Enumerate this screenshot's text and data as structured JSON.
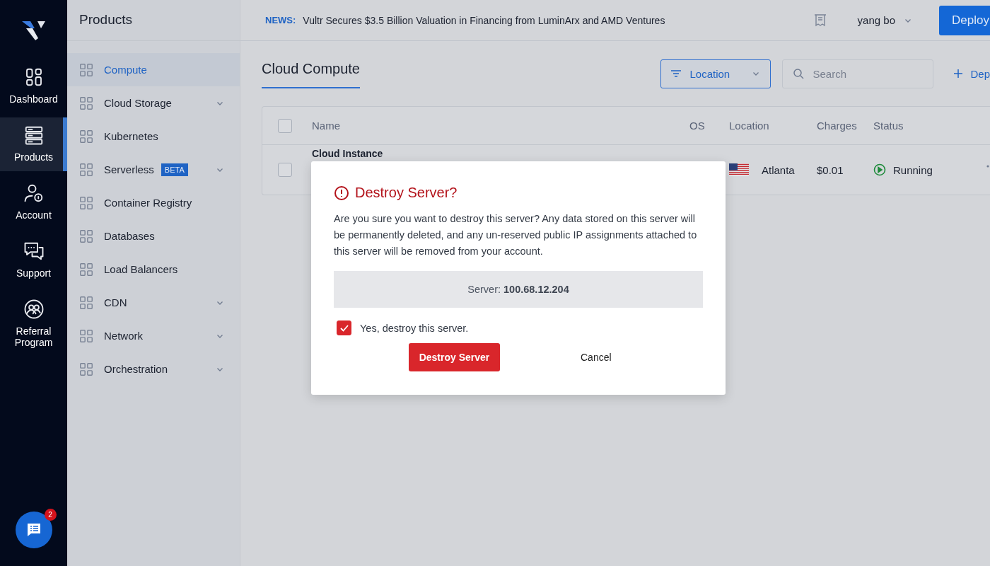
{
  "rail": {
    "items": [
      {
        "label": "Dashboard",
        "selected": false
      },
      {
        "label": "Products",
        "selected": true
      },
      {
        "label": "Account",
        "selected": false
      },
      {
        "label": "Support",
        "selected": false
      },
      {
        "label": "Referral Program",
        "selected": false
      }
    ],
    "chat": {
      "badge": "2"
    }
  },
  "sidebar": {
    "title": "Products",
    "items": [
      {
        "label": "Compute",
        "selected": true,
        "expandable": false
      },
      {
        "label": "Cloud Storage",
        "selected": false,
        "expandable": true
      },
      {
        "label": "Kubernetes",
        "selected": false,
        "expandable": false
      },
      {
        "label": "Serverless",
        "selected": false,
        "expandable": true,
        "badge": "BETA"
      },
      {
        "label": "Container Registry",
        "selected": false,
        "expandable": false
      },
      {
        "label": "Databases",
        "selected": false,
        "expandable": false
      },
      {
        "label": "Load Balancers",
        "selected": false,
        "expandable": false
      },
      {
        "label": "CDN",
        "selected": false,
        "expandable": true
      },
      {
        "label": "Network",
        "selected": false,
        "expandable": true
      },
      {
        "label": "Orchestration",
        "selected": false,
        "expandable": true
      }
    ]
  },
  "topbar": {
    "news_label": "NEWS:",
    "news": "Vultr Secures $3.5 Billion Valuation in Financing from LuminArx and AMD Ventures",
    "user": "yang bo",
    "deploy": "Deploy"
  },
  "page_title": "Cloud Compute",
  "filter": {
    "label": "Location"
  },
  "search": {
    "placeholder": "Search"
  },
  "add_link": "Dep",
  "table": {
    "select_all": {
      "checked": false
    },
    "columns": [
      "Name",
      "OS",
      "Location",
      "Charges",
      "Status"
    ],
    "rows": [
      {
        "selected": false,
        "name": "Cloud Instance",
        "location": "Atlanta",
        "charges": "$0.01",
        "status": "Running"
      }
    ]
  },
  "dialog": {
    "title": "Destroy Server?",
    "message": "Are you sure you want to destroy this server? Any data stored on this server will be permanently deleted, and any un-reserved public IP assignments attached to this server will be removed from your account.",
    "server": "Server: **100.68.12.204**",
    "confirm": {
      "label": "Yes, destroy this server.",
      "checked": true
    },
    "buttons": [
      "Destroy Server",
      "Cancel"
    ]
  }
}
